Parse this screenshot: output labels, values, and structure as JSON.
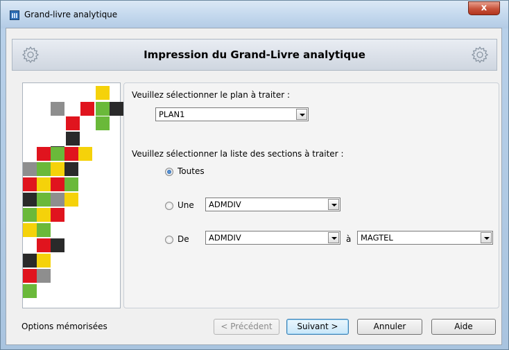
{
  "window": {
    "title": "Grand-livre analytique",
    "close_glyph": "x"
  },
  "header": {
    "title": "Impression du Grand-Livre analytique",
    "icon_left": "gear-icon",
    "icon_right": "gear-icon"
  },
  "form": {
    "plan_label": "Veuillez sélectionner le plan à traiter :",
    "plan_value": "PLAN1",
    "sections_label": "Veuillez sélectionner la liste des sections à traiter :",
    "option_all": "Toutes",
    "option_one": "Une",
    "option_one_value": "ADMDIV",
    "option_range": "De",
    "range_from_value": "ADMDIV",
    "range_to_label": "à",
    "range_to_value": "MAGTEL",
    "selected_option": "Toutes"
  },
  "footer": {
    "memorized_options": "Options mémorisées",
    "prev_button": "< Précédent",
    "next_button": "Suivant >",
    "cancel_button": "Annuler",
    "help_button": "Aide"
  },
  "colors": {
    "yellow": "#f5d20a",
    "red": "#e0141e",
    "green": "#6ab93a",
    "dark": "#2a2a2a",
    "gray": "#8e8e8e",
    "window_border": "#6b879e",
    "close_button": "#c7523a",
    "primary_button": "#c9e7f9"
  }
}
